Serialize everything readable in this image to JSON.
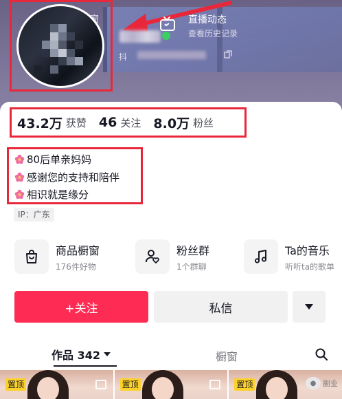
{
  "header": {
    "storefront_label": "橱窗",
    "id_prefix": "抖",
    "live": {
      "title": "直播动态",
      "subtitle": "查看历史记录"
    }
  },
  "stats": [
    {
      "value": "43.2万",
      "label": "获赞"
    },
    {
      "value": "46",
      "label": "关注"
    },
    {
      "value": "8.0万",
      "label": "粉丝"
    }
  ],
  "bio": [
    "80后单亲妈妈",
    "感谢您的支持和陪伴",
    "相识就是缘分"
  ],
  "ip_tag": "IP：广东",
  "features": [
    {
      "title": "商品橱窗",
      "subtitle": "176件好物",
      "icon": "shopping-bag-icon"
    },
    {
      "title": "粉丝群",
      "subtitle": "1个群聊",
      "icon": "fan-group-icon"
    },
    {
      "title": "Ta的音乐",
      "subtitle": "听听ta的歌单",
      "icon": "music-note-icon"
    }
  ],
  "actions": {
    "follow": "+关注",
    "message": "私信"
  },
  "tabs": {
    "works": "作品 342",
    "storefront": "橱窗"
  },
  "thumbs": [
    {
      "badge": "置顶"
    },
    {
      "badge": "置顶"
    },
    {
      "badge": "置顶"
    }
  ],
  "watermark": "副业",
  "colors": {
    "accent": "#fe2c55",
    "highlight_box": "#e8283a",
    "pin_badge": "#fcd12a",
    "header_bg": "#7d7599"
  }
}
